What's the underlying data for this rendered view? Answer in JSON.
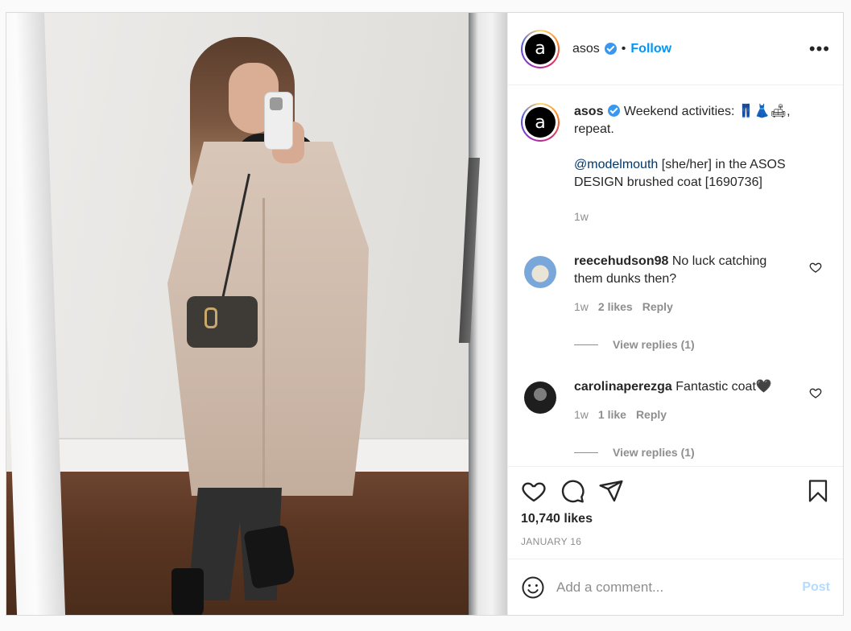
{
  "header": {
    "username": "asos",
    "avatar_letter": "a",
    "follow_label": "Follow",
    "separator": "•",
    "more_label": "•••"
  },
  "caption": {
    "username": "asos",
    "text": "Weekend activities: 👖👗🛋, repeat.",
    "mention": "@modelmouth",
    "text2": " [she/her] in the ASOS DESIGN brushed coat [1690736]",
    "time": "1w"
  },
  "comments": [
    {
      "username": "reecehudson98",
      "text": "No luck catching them dunks then?",
      "time": "1w",
      "likes": "2 likes",
      "reply": "Reply",
      "view_replies": "View replies (1)"
    },
    {
      "username": "carolinaperezga",
      "text": "Fantastic coat🖤",
      "time": "1w",
      "likes": "1 like",
      "reply": "Reply",
      "view_replies": "View replies (1)"
    }
  ],
  "actions": {
    "likes": "10,740 likes",
    "date": "JANUARY 16"
  },
  "add_comment": {
    "placeholder": "Add a comment...",
    "post_label": "Post"
  },
  "colors": {
    "link_blue": "#0095f6",
    "post_disabled": "#b3dbff",
    "muted": "#8e8e8e"
  }
}
